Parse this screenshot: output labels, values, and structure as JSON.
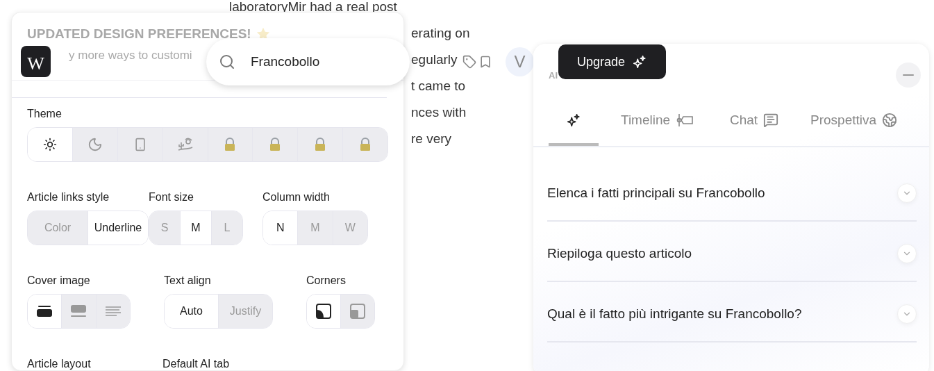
{
  "article": {
    "lines": [
      "laboratoryMir had a real post",
      "erating on",
      "egularly",
      "t came to",
      "nces with",
      "re very"
    ]
  },
  "settings": {
    "banner_title": "UPDATED DESIGN PREFERENCES!",
    "banner_text": "y more ways to customi",
    "logo": "W",
    "theme": {
      "label": "Theme",
      "options": [
        {
          "kind": "sun",
          "selected": true
        },
        {
          "kind": "moon",
          "selected": false
        },
        {
          "kind": "phone",
          "selected": false
        },
        {
          "kind": "desert",
          "selected": false
        },
        {
          "kind": "locked",
          "selected": false
        },
        {
          "kind": "locked",
          "selected": false
        },
        {
          "kind": "locked",
          "selected": false
        },
        {
          "kind": "locked",
          "selected": false
        }
      ]
    },
    "rows": [
      [
        {
          "label": "Article links style",
          "options": [
            {
              "text": "Color",
              "selected": false
            },
            {
              "text": "Underline",
              "selected": true
            }
          ]
        },
        {
          "label": "Font size",
          "options": [
            {
              "text": "S",
              "selected": false
            },
            {
              "text": "M",
              "selected": true
            },
            {
              "text": "L",
              "selected": false
            }
          ]
        },
        {
          "label": "Column width",
          "options": [
            {
              "text": "N",
              "selected": true
            },
            {
              "text": "M",
              "selected": false
            },
            {
              "text": "W",
              "selected": false
            }
          ]
        }
      ],
      [
        {
          "label": "Cover image",
          "options": [
            {
              "kind": "cover-full",
              "selected": true
            },
            {
              "kind": "cover-inset",
              "selected": false
            },
            {
              "kind": "text-lines",
              "selected": false
            }
          ]
        },
        {
          "label": "Text align",
          "options": [
            {
              "text": "Auto",
              "selected": true
            },
            {
              "text": "Justify",
              "selected": false
            }
          ]
        },
        {
          "label": "Corners",
          "options": [
            {
              "kind": "rounded",
              "selected": true
            },
            {
              "kind": "square",
              "selected": false
            }
          ]
        }
      ],
      [
        {
          "label": "Article layout"
        },
        {
          "label": "Default AI tab"
        }
      ]
    ]
  },
  "search": {
    "value": "Francobollo"
  },
  "avatar": "V",
  "ai_panel": {
    "label": "AI",
    "upgrade": "Upgrade",
    "tabs": [
      {
        "kind": "sparkle",
        "selected": true
      },
      {
        "kind": "timeline",
        "label": "Timeline",
        "selected": false
      },
      {
        "kind": "chat",
        "label": "Chat",
        "selected": false
      },
      {
        "kind": "globe",
        "label": "Prospettiva",
        "selected": false
      }
    ],
    "questions": [
      "Elenca i fatti principali su Francobollo",
      "Riepiloga questo articolo",
      "Qual è il fatto più intrigante su Francobollo?"
    ]
  }
}
